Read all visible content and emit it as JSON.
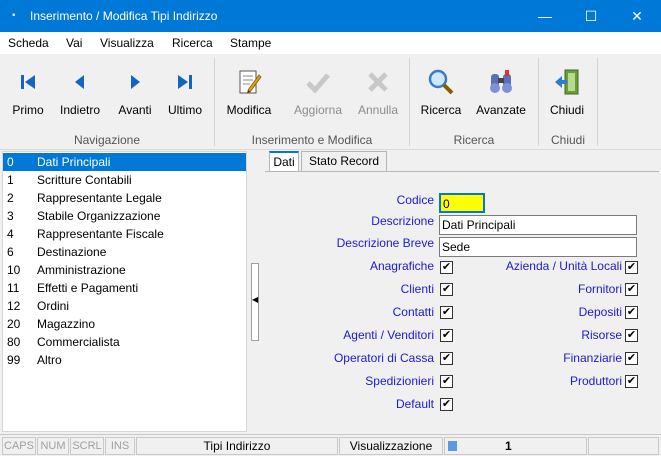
{
  "window": {
    "title": "Inserimento / Modifica Tipi Indirizzo",
    "minimize": "—",
    "maximize": "☐",
    "close": "✕"
  },
  "menu": [
    "Scheda",
    "Vai",
    "Visualizza",
    "Ricerca",
    "Stampe"
  ],
  "ribbon": {
    "buttons": {
      "primo": "Primo",
      "indietro": "Indietro",
      "avanti": "Avanti",
      "ultimo": "Ultimo",
      "modifica": "Modifica",
      "aggiorna": "Aggiorna",
      "annulla": "Annulla",
      "ricerca": "Ricerca",
      "avanzate": "Avanzate",
      "chiudi": "Chiudi"
    },
    "groups": {
      "navigazione": "Navigazione",
      "inserimento": "Inserimento e Modifica",
      "ricerca": "Ricerca",
      "chiudi": "Chiudi"
    },
    "icons": {
      "primo": "first-record-icon",
      "indietro": "previous-record-icon",
      "avanti": "next-record-icon",
      "ultimo": "last-record-icon",
      "modifica": "edit-document-icon",
      "aggiorna": "checkmark-icon",
      "annulla": "cancel-x-icon",
      "ricerca": "magnifier-icon",
      "avanzate": "binoculars-icon",
      "chiudi": "exit-door-icon"
    }
  },
  "list": {
    "items": [
      {
        "code": "0",
        "name": "Dati Principali"
      },
      {
        "code": "1",
        "name": "Scritture Contabili"
      },
      {
        "code": "2",
        "name": "Rappresentante Legale"
      },
      {
        "code": "3",
        "name": "Stabile Organizzazione"
      },
      {
        "code": "4",
        "name": "Rappresentante Fiscale"
      },
      {
        "code": "6",
        "name": "Destinazione"
      },
      {
        "code": "10",
        "name": "Amministrazione"
      },
      {
        "code": "11",
        "name": "Effetti e Pagamenti"
      },
      {
        "code": "12",
        "name": "Ordini"
      },
      {
        "code": "20",
        "name": "Magazzino"
      },
      {
        "code": "80",
        "name": "Commercialista"
      },
      {
        "code": "99",
        "name": "Altro"
      }
    ]
  },
  "tabs": [
    "Dati",
    "Stato Record"
  ],
  "form": {
    "codice_label": "Codice",
    "codice_value": "0",
    "descrizione_label": "Descrizione",
    "descrizione_value": "Dati Principali",
    "descrizione_breve_label": "Descrizione Breve",
    "descrizione_breve_value": "Sede",
    "left_checks": [
      {
        "label": "Anagrafiche",
        "checked": "✔"
      },
      {
        "label": "Clienti",
        "checked": "✔"
      },
      {
        "label": "Contatti",
        "checked": "✔"
      },
      {
        "label": "Agenti / Venditori",
        "checked": "✔"
      },
      {
        "label": "Operatori di Cassa",
        "checked": "✔"
      },
      {
        "label": "Spedizionieri",
        "checked": "✔"
      },
      {
        "label": "Default",
        "checked": "✔"
      }
    ],
    "right_checks": [
      {
        "label": "Azienda / Unità Locali",
        "checked": "✔"
      },
      {
        "label": "Fornitori",
        "checked": "✔"
      },
      {
        "label": "Depositi",
        "checked": "✔"
      },
      {
        "label": "Risorse",
        "checked": "✔"
      },
      {
        "label": "Finanziarie",
        "checked": "✔"
      },
      {
        "label": "Produttori",
        "checked": "✔"
      }
    ]
  },
  "status": {
    "caps": "CAPS",
    "num": "NUM",
    "scrl": "SCRL",
    "ins": "INS",
    "table": "Tipi Indirizzo",
    "mode": "Visualizzazione",
    "record": "1"
  },
  "colors": {
    "titlebar": "#0078d7",
    "selection": "#0078d7",
    "label_blue": "#1a1ad6",
    "code_highlight": "#ffff00"
  }
}
